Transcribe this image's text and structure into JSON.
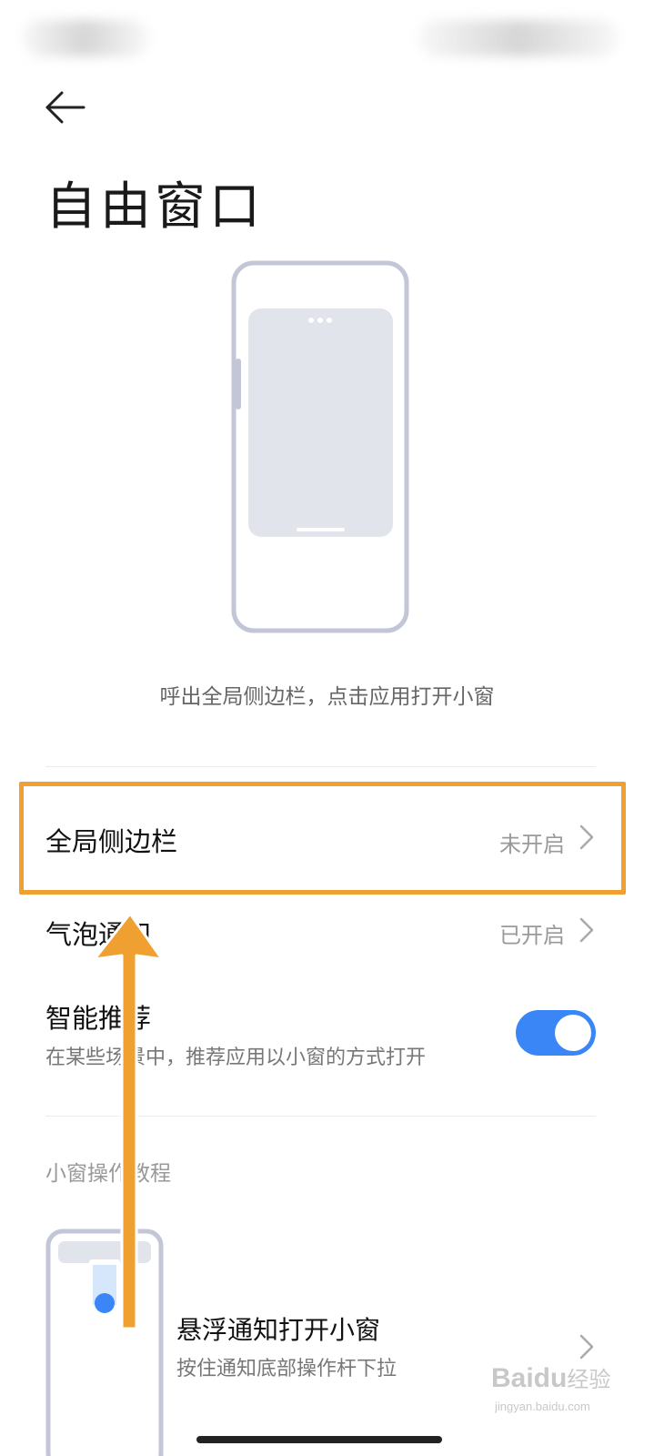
{
  "page": {
    "title": "自由窗口",
    "caption": "呼出全局侧边栏，点击应用打开小窗"
  },
  "icons": {
    "back": "arrow-left-icon",
    "chevron": "chevron-right-icon"
  },
  "settings": {
    "sidebar": {
      "label": "全局侧边栏",
      "value": "未开启"
    },
    "bubble": {
      "label": "气泡通知",
      "value": "已开启"
    },
    "smart": {
      "label": "智能推荐",
      "sublabel": "在某些场景中，推荐应用以小窗的方式打开",
      "enabled": true
    }
  },
  "tutorial": {
    "section_label": "小窗操作教程",
    "items": [
      {
        "title": "悬浮通知打开小窗",
        "subtitle": "按住通知底部操作杆下拉"
      }
    ]
  },
  "watermark": {
    "brand_latin": "Baidu",
    "brand_zh": "经验",
    "url": "jingyan.baidu.com"
  },
  "colors": {
    "accent": "#3a86f6",
    "annotation": "#f0a030",
    "illustration_stroke": "#c3c6d6",
    "illustration_fill": "#e2e4ec"
  }
}
